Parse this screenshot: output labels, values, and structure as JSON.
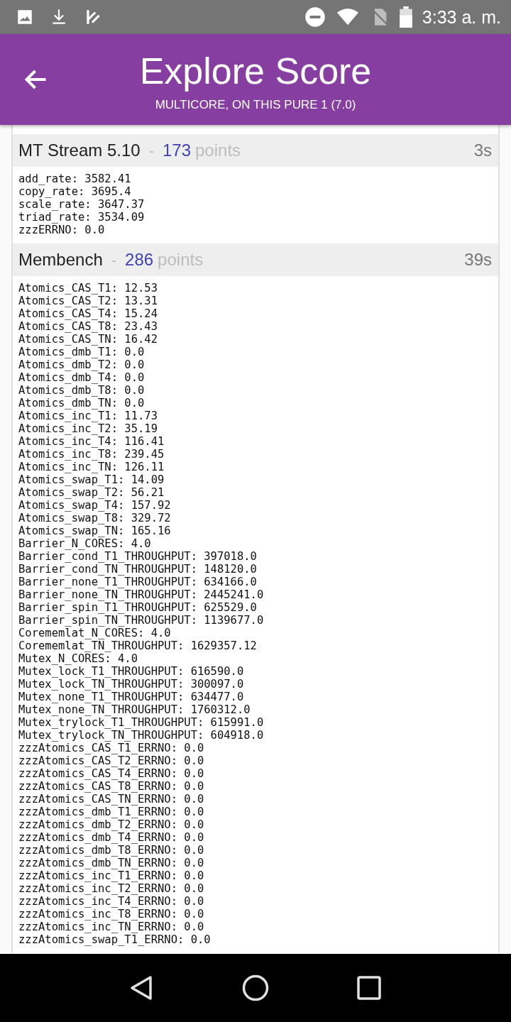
{
  "status_bar": {
    "time": "3:33 a. m."
  },
  "header": {
    "title": "Explore Score",
    "subtitle": "MULTICORE, ON THIS PURE 1 (7.0)"
  },
  "sections": [
    {
      "name": "MT Stream 5.10",
      "separator": "-",
      "score": "173",
      "unit": "points",
      "duration": "3s",
      "lines": [
        "add_rate: 3582.41",
        "copy_rate: 3695.4",
        "scale_rate: 3647.37",
        "triad_rate: 3534.09",
        "zzzERRNO: 0.0"
      ]
    },
    {
      "name": "Membench",
      "separator": "-",
      "score": "286",
      "unit": "points",
      "duration": "39s",
      "lines": [
        "Atomics_CAS_T1: 12.53",
        "Atomics_CAS_T2: 13.31",
        "Atomics_CAS_T4: 15.24",
        "Atomics_CAS_T8: 23.43",
        "Atomics_CAS_TN: 16.42",
        "Atomics_dmb_T1: 0.0",
        "Atomics_dmb_T2: 0.0",
        "Atomics_dmb_T4: 0.0",
        "Atomics_dmb_T8: 0.0",
        "Atomics_dmb_TN: 0.0",
        "Atomics_inc_T1: 11.73",
        "Atomics_inc_T2: 35.19",
        "Atomics_inc_T4: 116.41",
        "Atomics_inc_T8: 239.45",
        "Atomics_inc_TN: 126.11",
        "Atomics_swap_T1: 14.09",
        "Atomics_swap_T2: 56.21",
        "Atomics_swap_T4: 157.92",
        "Atomics_swap_T8: 329.72",
        "Atomics_swap_TN: 165.16",
        "Barrier_N_CORES: 4.0",
        "Barrier_cond_T1_THROUGHPUT: 397018.0",
        "Barrier_cond_TN_THROUGHPUT: 148120.0",
        "Barrier_none_T1_THROUGHPUT: 634166.0",
        "Barrier_none_TN_THROUGHPUT: 2445241.0",
        "Barrier_spin_T1_THROUGHPUT: 625529.0",
        "Barrier_spin_TN_THROUGHPUT: 1139677.0",
        "Corememlat_N_CORES: 4.0",
        "Corememlat_TN_THROUGHPUT: 1629357.12",
        "Mutex_N_CORES: 4.0",
        "Mutex_lock_T1_THROUGHPUT: 616590.0",
        "Mutex_lock_TN_THROUGHPUT: 300097.0",
        "Mutex_none_T1_THROUGHPUT: 634477.0",
        "Mutex_none_TN_THROUGHPUT: 1760312.0",
        "Mutex_trylock_T1_THROUGHPUT: 615991.0",
        "Mutex_trylock_TN_THROUGHPUT: 604918.0",
        "zzzAtomics_CAS_T1_ERRNO: 0.0",
        "zzzAtomics_CAS_T2_ERRNO: 0.0",
        "zzzAtomics_CAS_T4_ERRNO: 0.0",
        "zzzAtomics_CAS_T8_ERRNO: 0.0",
        "zzzAtomics_CAS_TN_ERRNO: 0.0",
        "zzzAtomics_dmb_T1_ERRNO: 0.0",
        "zzzAtomics_dmb_T2_ERRNO: 0.0",
        "zzzAtomics_dmb_T4_ERRNO: 0.0",
        "zzzAtomics_dmb_T8_ERRNO: 0.0",
        "zzzAtomics_dmb_TN_ERRNO: 0.0",
        "zzzAtomics_inc_T1_ERRNO: 0.0",
        "zzzAtomics_inc_T2_ERRNO: 0.0",
        "zzzAtomics_inc_T4_ERRNO: 0.0",
        "zzzAtomics_inc_T8_ERRNO: 0.0",
        "zzzAtomics_inc_TN_ERRNO: 0.0",
        "zzzAtomics_swap_T1_ERRNO: 0.0"
      ]
    }
  ]
}
